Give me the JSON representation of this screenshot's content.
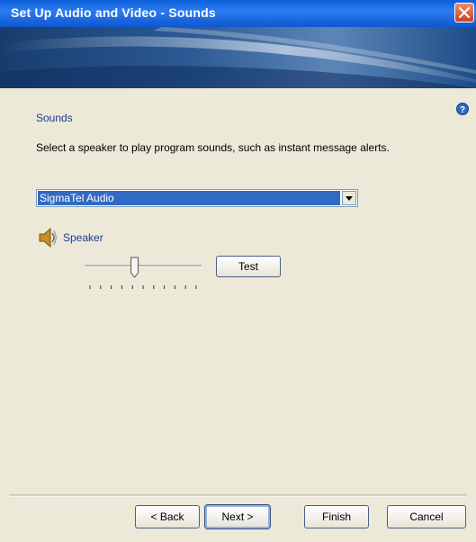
{
  "window": {
    "title": "Set Up Audio and Video - Sounds"
  },
  "content": {
    "section_title": "Sounds",
    "description": "Select a speaker to play program sounds, such as instant message alerts.",
    "speaker_select": {
      "selected": "SigmaTel Audio"
    },
    "speaker": {
      "label": "Speaker",
      "volume_level": 0.42,
      "test_label": "Test"
    }
  },
  "footer": {
    "back_label": "< Back",
    "next_label": "Next >",
    "finish_label": "Finish",
    "cancel_label": "Cancel"
  },
  "colors": {
    "titlebar": "#0a5fd8",
    "accent_text": "#1b3c8f",
    "selection": "#316ac5",
    "background": "#ece9d8"
  }
}
